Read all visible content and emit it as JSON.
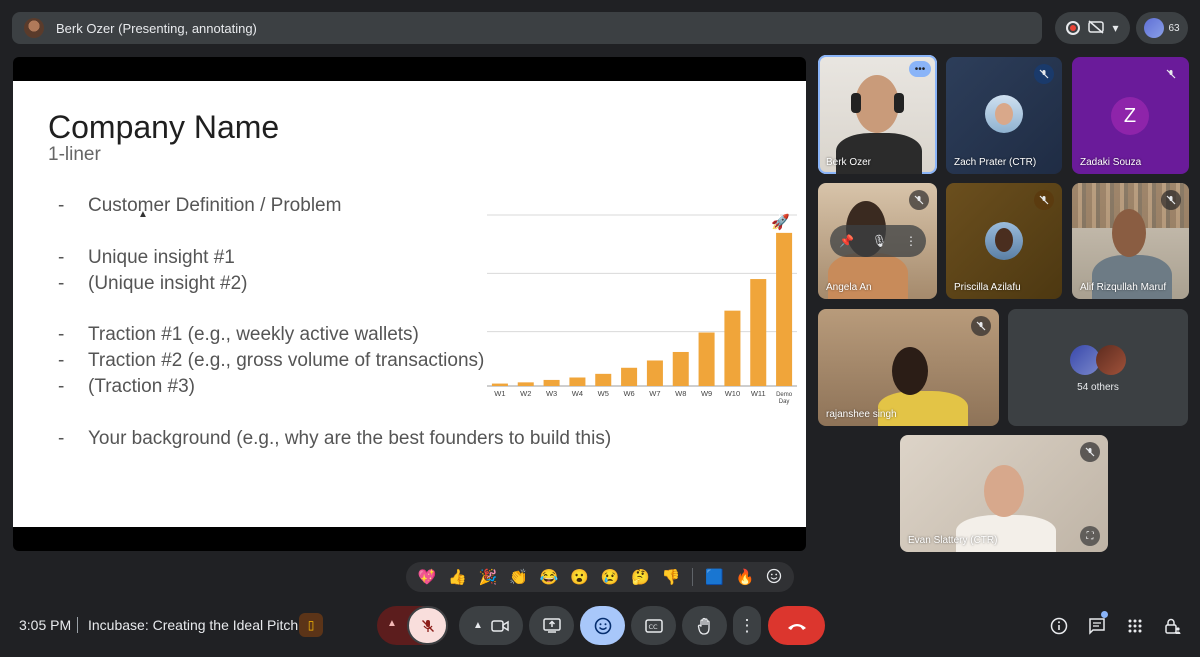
{
  "presenter_bar": {
    "title": "Berk Ozer (Presenting, annotating)"
  },
  "top_controls": {
    "people_count": "63"
  },
  "slide": {
    "title": "Company Name",
    "subtitle": "1-liner",
    "bullets": [
      {
        "dash": "-",
        "text": "Customer Definition / Problem"
      },
      {
        "dash": "-",
        "text": "Unique insight #1"
      },
      {
        "dash": "-",
        "text": "(Unique insight #2)"
      },
      {
        "dash": "-",
        "text": "Traction #1 (e.g., weekly active wallets)"
      },
      {
        "dash": "-",
        "text": "Traction #2 (e.g., gross volume of transactions)"
      },
      {
        "dash": "-",
        "text": "(Traction #3)"
      },
      {
        "dash": "-",
        "text": "Your background (e.g., why are the best founders to build this)"
      }
    ]
  },
  "chart_data": {
    "type": "bar",
    "title": "",
    "categories": [
      "W1",
      "W2",
      "W3",
      "W4",
      "W5",
      "W6",
      "W7",
      "W8",
      "W9",
      "W10",
      "W11",
      "Demo Day"
    ],
    "values": [
      1,
      1.5,
      2.5,
      3.5,
      5,
      7.5,
      10.5,
      14,
      22,
      31,
      44,
      63
    ],
    "ylim": [
      0,
      72
    ],
    "grid": true,
    "bar_color": "#f0a53a",
    "annotation": "rocket-emoji"
  },
  "participants": [
    {
      "name": "Berk Ozer",
      "mic": "on",
      "avatar": "video"
    },
    {
      "name": "Zach Prater (CTR)",
      "mic": "muted",
      "avatar": "photo"
    },
    {
      "name": "Zadaki Souza",
      "mic": "muted",
      "avatar": "Z"
    },
    {
      "name": "Angela An",
      "mic": "muted",
      "avatar": "video"
    },
    {
      "name": "Priscilla Azilafu",
      "mic": "muted",
      "avatar": "photo"
    },
    {
      "name": "Alif Rizqullah Maruf",
      "mic": "muted",
      "avatar": "video"
    },
    {
      "name": "rajanshee singh",
      "mic": "muted",
      "avatar": "video"
    },
    {
      "name": "Evan Slattery (CTR)",
      "mic": "muted",
      "avatar": "video"
    }
  ],
  "others": {
    "label": "54 others"
  },
  "reactions": [
    "💖",
    "👍",
    "🎉",
    "👏",
    "😂",
    "😮",
    "😢",
    "🤔",
    "👎",
    "🟦",
    "🔥"
  ],
  "bottom_bar": {
    "time": "3:05 PM",
    "meeting_name": "Incubase: Creating the Ideal Pitch"
  },
  "colors": {
    "accent": "#8ab4f8",
    "end_call": "#dc362e",
    "mic_muted_bg": "#f9dedc",
    "emoji_active": "#a8c7fa"
  }
}
